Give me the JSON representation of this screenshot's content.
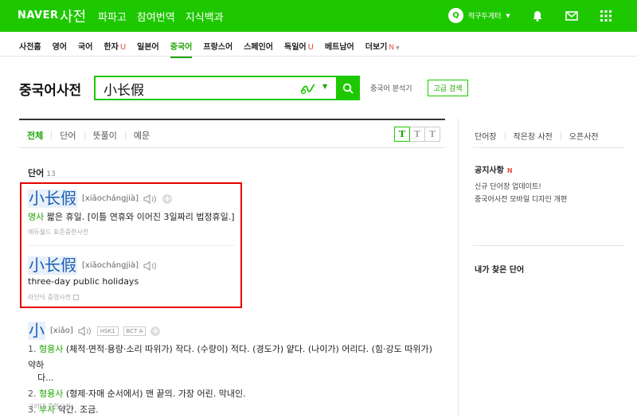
{
  "header": {
    "naver": "NAVER",
    "dict": "사전",
    "nav": [
      "파파고",
      "참여번역",
      "지식백과"
    ],
    "user_name": "적구두게터",
    "accent": "#1ec800"
  },
  "tabs": [
    {
      "label": "사전홈"
    },
    {
      "label": "영어"
    },
    {
      "label": "국어"
    },
    {
      "label": "한자",
      "sup": "U"
    },
    {
      "label": "일본어"
    },
    {
      "label": "중국어",
      "active": true
    },
    {
      "label": "프랑스어"
    },
    {
      "label": "스페인어"
    },
    {
      "label": "독일어",
      "sup": "U"
    },
    {
      "label": "베트남어"
    },
    {
      "label": "더보기",
      "sup": "N"
    }
  ],
  "search": {
    "title": "중국어사전",
    "query": "小长假",
    "analyzer": "중국어 분석기",
    "advanced": "고급 검색"
  },
  "filters": [
    "전체",
    "단어",
    "뜻풀이",
    "예문"
  ],
  "text_size": [
    "T",
    "T",
    "T"
  ],
  "results": {
    "section_label": "단어",
    "section_count": "13",
    "entries": [
      {
        "hanzi": "小长假",
        "pinyin": "[xiǎochángjià]",
        "pos": "명사",
        "gloss": "짧은 휴일. [이틀 연휴와 이어진 3일짜리 법정휴일.]",
        "source": "에듀월드 표준중한사전"
      },
      {
        "hanzi": "小长假",
        "pinyin": "[xiǎochángjià]",
        "gloss": "three-day public holidays",
        "source": "라인딕 중영사전"
      },
      {
        "hanzi": "小",
        "pinyin": "[xiǎo]",
        "badges": [
          "HSK1",
          "BCT A"
        ],
        "defs": [
          {
            "num": "1.",
            "pos": "형용사",
            "text": "(체적·면적·용량·소리 따위가) 작다. (수량이) 적다. (경도가) 얕다. (나이가) 어리다. (힘·강도 따위가) 약하"
          },
          {
            "num": "",
            "pos": "",
            "text": "다..."
          },
          {
            "num": "2.",
            "pos": "형용사",
            "text": "(형제·자매 순서에서) 맨 끝의. 가장 어린. 막내인."
          },
          {
            "num": "3.",
            "pos": "부사",
            "text": "약간. 조금."
          }
        ],
        "source": "고려대 중한사전"
      }
    ]
  },
  "right": {
    "links": [
      "단어장",
      "작은창 사전",
      "오픈사전"
    ],
    "notice_title": "공지사항",
    "notice_new": "N",
    "notices": [
      "신규 단어장 업데이트!",
      "중국어사전 모바일 디자인 개편"
    ],
    "my_words": "내가 찾은 단어"
  }
}
